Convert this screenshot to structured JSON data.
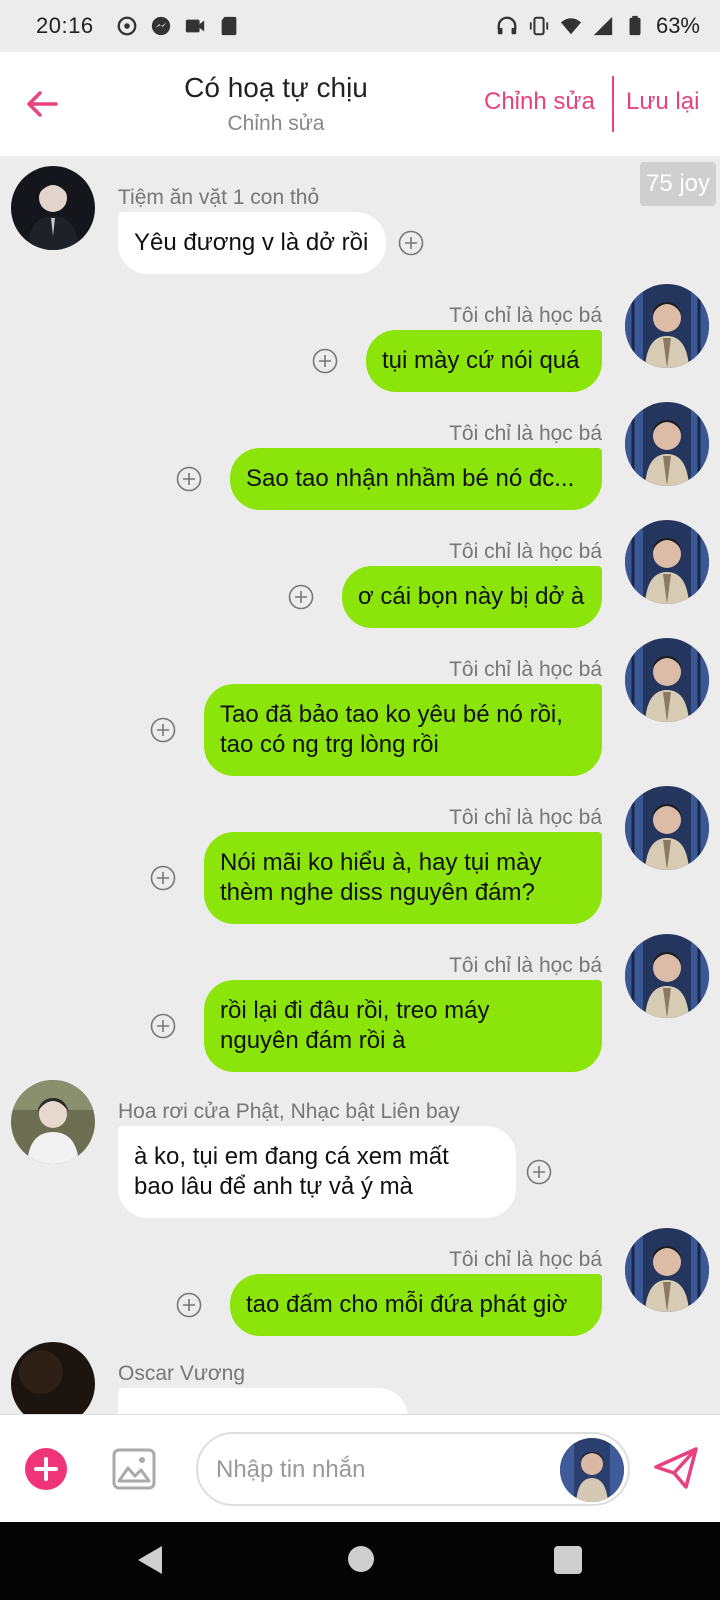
{
  "status_bar": {
    "time": "20:16",
    "battery": "63%"
  },
  "header": {
    "title": "Có hoạ tự chịu",
    "subtitle": "Chỉnh sửa",
    "edit_label": "Chỉnh sửa",
    "save_label": "Lưu lại"
  },
  "joy_badge": "75 joy",
  "messages": [
    {
      "sender": "Tiệm ăn vặt 1 con thỏ",
      "lines": [
        "Yêu đương v là dở rồi"
      ],
      "side": "left"
    },
    {
      "sender": "Tôi chỉ là học bá",
      "lines": [
        "tụi mày cứ nói quá"
      ],
      "side": "right"
    },
    {
      "sender": "Tôi chỉ là học bá",
      "lines": [
        "Sao tao nhận nhầm bé nó đc..."
      ],
      "side": "right"
    },
    {
      "sender": "Tôi chỉ là học bá",
      "lines": [
        "ơ cái bọn này bị dở à"
      ],
      "side": "right"
    },
    {
      "sender": "Tôi chỉ là học bá",
      "lines": [
        "Tao đã bảo tao ko yêu bé nó rồi,",
        "tao có ng trg lòng rồi"
      ],
      "side": "right"
    },
    {
      "sender": "Tôi chỉ là học bá",
      "lines": [
        "Nói mãi ko hiểu à, hay tụi mày",
        "thèm nghe diss nguyên đám?"
      ],
      "side": "right"
    },
    {
      "sender": "Tôi chỉ là học bá",
      "lines": [
        "rồi lại đi đâu rồi, treo máy",
        "nguyên đám rồi à"
      ],
      "side": "right"
    },
    {
      "sender": "Hoa rơi cửa Phật, Nhạc bật Liên bay",
      "lines": [
        "à ko, tụi em đang cá xem mất",
        "bao lâu để anh tự vả ý mà"
      ],
      "side": "left"
    },
    {
      "sender": "Tôi chỉ là học bá",
      "lines": [
        "tao đấm cho mỗi đứa phát giờ"
      ],
      "side": "right"
    },
    {
      "sender": "Oscar Vương",
      "lines": [
        ""
      ],
      "side": "left"
    }
  ],
  "input": {
    "placeholder": "Nhập tin nhắn"
  },
  "colors": {
    "accent": "#e8417f",
    "own_bubble": "#8be40a",
    "other_bubble": "#ffffff",
    "background": "#ececec"
  }
}
